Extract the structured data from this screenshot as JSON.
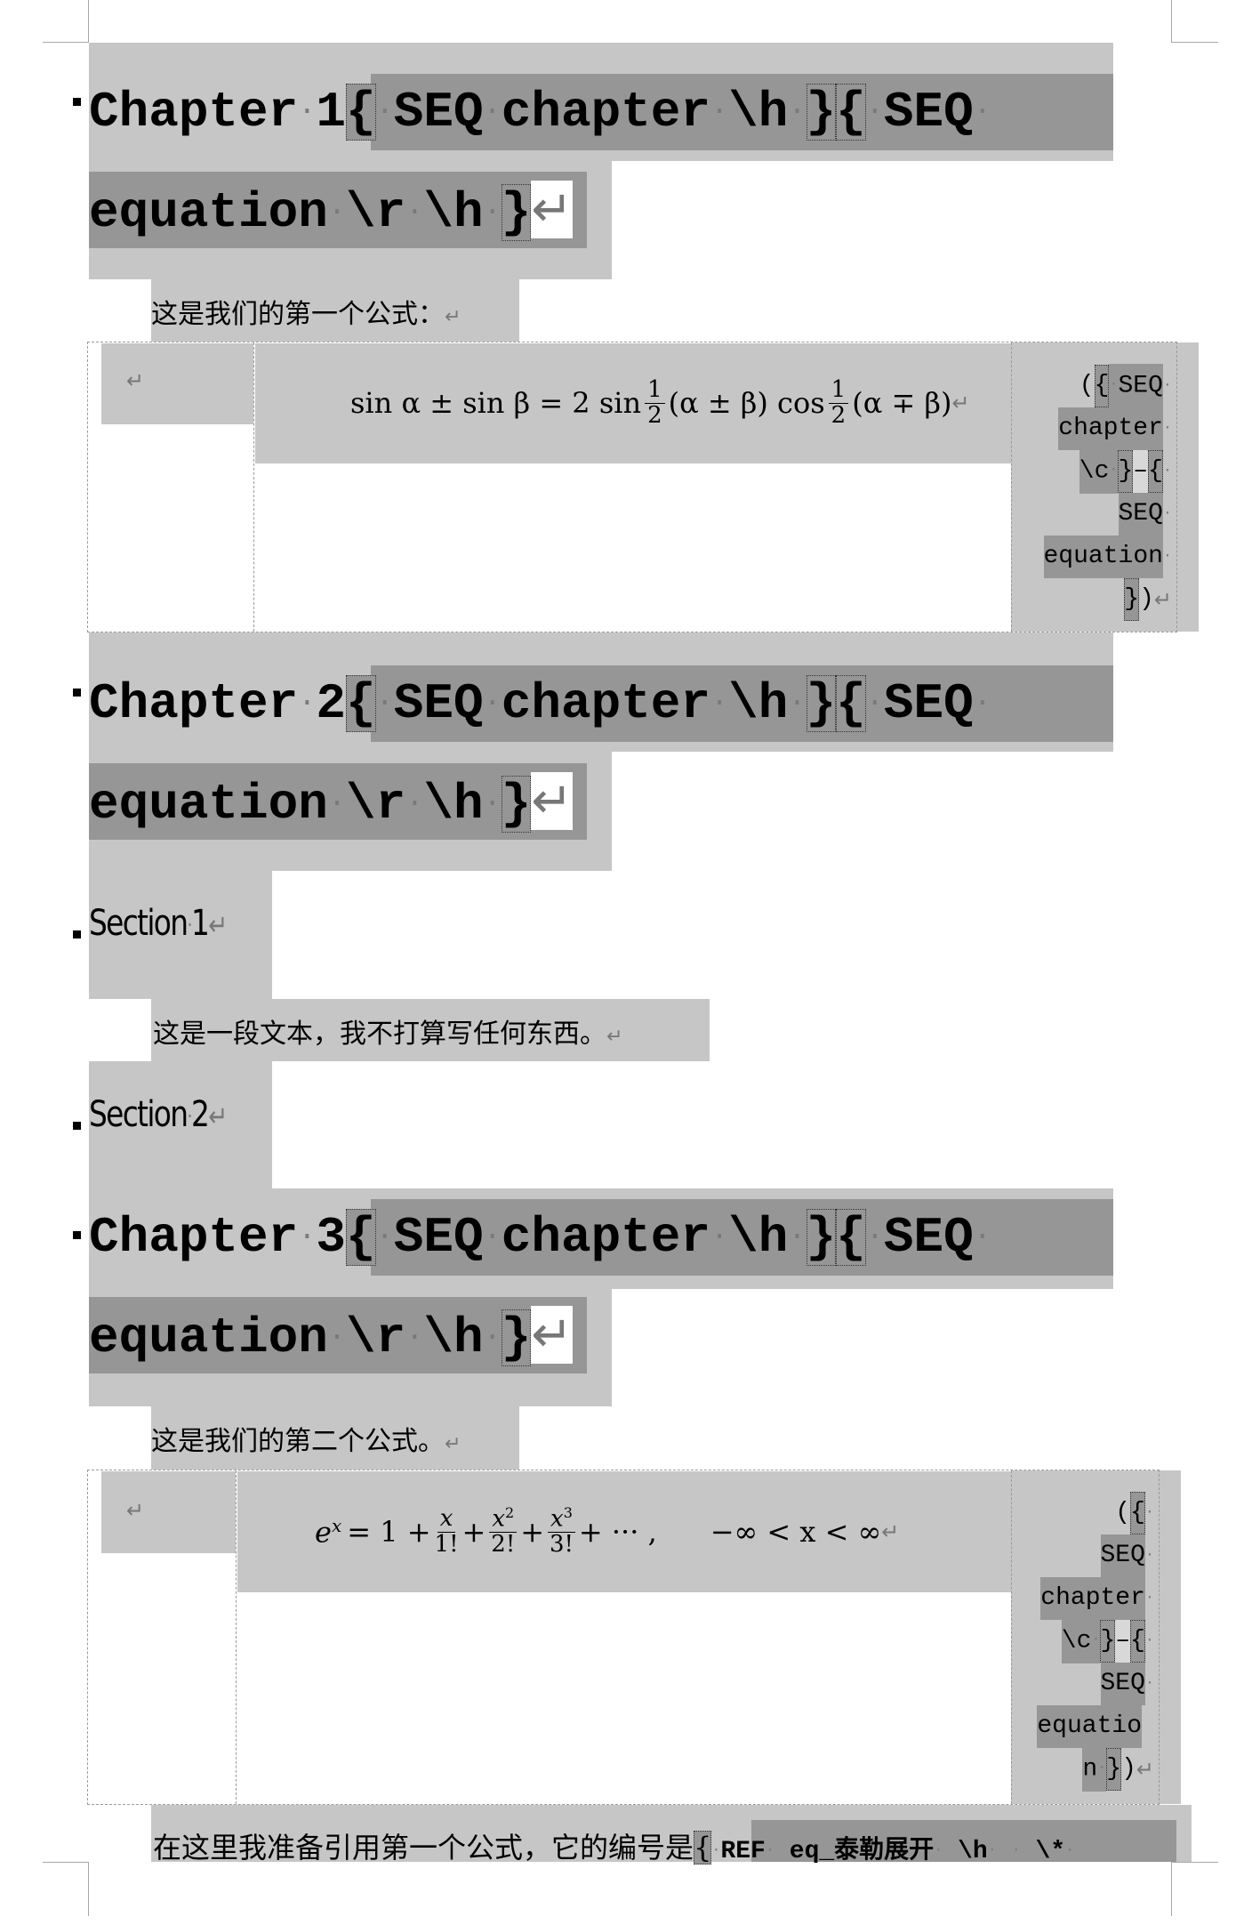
{
  "document": {
    "chapters": [
      {
        "title": "Chapter",
        "number": "1",
        "field_line1": [
          "SEQ",
          "chapter",
          "\\h",
          "SEQ"
        ],
        "field_line2": [
          "equation",
          "\\r",
          "\\h"
        ]
      },
      {
        "title": "Chapter",
        "number": "2",
        "field_line1": [
          "SEQ",
          "chapter",
          "\\h",
          "SEQ"
        ],
        "field_line2": [
          "equation",
          "\\r",
          "\\h"
        ]
      },
      {
        "title": "Chapter",
        "number": "3",
        "field_line1": [
          "SEQ",
          "chapter",
          "\\h",
          "SEQ"
        ],
        "field_line2": [
          "equation",
          "\\r",
          "\\h"
        ]
      }
    ],
    "paragraphs": {
      "intro_eq1": "这是我们的第一个公式：",
      "section1_body": "这是一段文本，我不打算写任何东西。",
      "intro_eq2": "这是我们的第二个公式。",
      "reference_text": "在这里我准备引用第一个公式，它的编号是",
      "reference_field": [
        "REF",
        "eq_泰勒展开",
        "\\h",
        "\\*"
      ]
    },
    "sections": [
      {
        "title": "Section",
        "number": "1"
      },
      {
        "title": "Section",
        "number": "2"
      }
    ],
    "equations": [
      {
        "latex": "\\sin\\alpha \\pm \\sin\\beta = 2\\sin\\frac{1}{2}(\\alpha\\pm\\beta)\\cos\\frac{1}{2}(\\alpha\\mp\\beta)",
        "parts": {
          "lhs": "sin α ± sin β = 2 sin",
          "frac1_num": "1",
          "frac1_den": "2",
          "mid": "(α ± β) cos",
          "frac2_num": "1",
          "frac2_den": "2",
          "tail": "(α ∓ β)"
        },
        "number_field_lines": [
          "({·SEQ·",
          "chapter·",
          "\\c·}–{·",
          "SEQ·",
          "equation·",
          "})"
        ]
      },
      {
        "latex": "e^x = 1 + \\frac{x}{1!} + \\frac{x^2}{2!} + \\frac{x^3}{3!} + \\cdots, \\quad -\\infty < x < \\infty",
        "parts": {
          "lhs": "e",
          "lhs_sup": "x",
          "eq": "= 1 +",
          "f1_num": "x",
          "f1_den": "1!",
          "f2_num": "x",
          "f2_num_sup": "2",
          "f2_den": "2!",
          "f3_num": "x",
          "f3_num_sup": "3",
          "f3_den": "3!",
          "tail": "+ ··· ,",
          "domain": "−∞ < x < ∞"
        },
        "number_field_lines": [
          "({·",
          "SEQ·",
          "chapter·",
          "\\c·}–{·",
          "SEQ·",
          "equatio",
          "n·})"
        ]
      }
    ],
    "marks": {
      "paragraph_mark": "↵",
      "space_dot": "·",
      "brace_open": "{",
      "brace_close": "}",
      "dash": "–",
      "paren_open": "(",
      "paren_close": ")"
    }
  }
}
